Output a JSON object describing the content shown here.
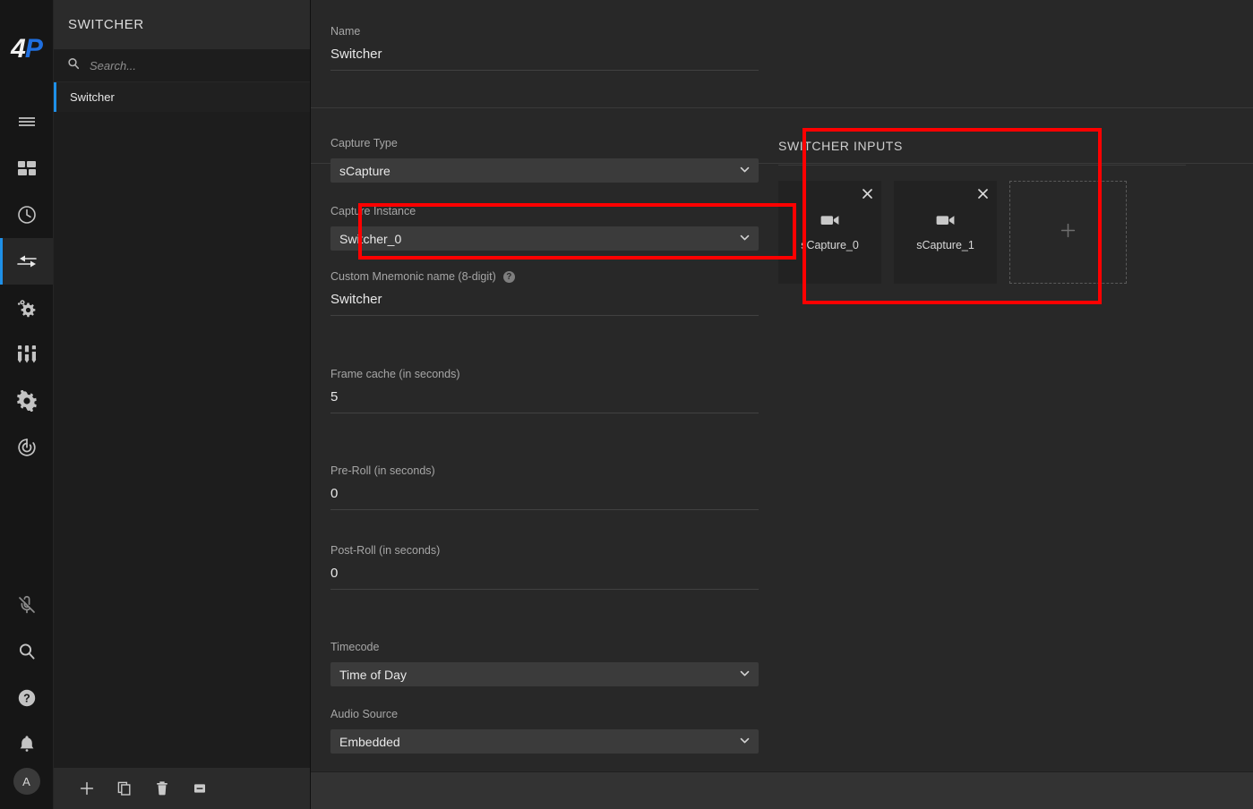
{
  "brand": {
    "logo_part1": "4",
    "logo_part2": "P",
    "accent_blue": "#1e90e8",
    "highlight_red": "#ff0000"
  },
  "rail": {
    "items": [
      {
        "icon": "hamburger-menu-icon",
        "label": "Menu"
      },
      {
        "icon": "dashboard-grid-icon",
        "label": "Dashboard"
      },
      {
        "icon": "clock-history-icon",
        "label": "History"
      },
      {
        "icon": "switcher-arrows-icon",
        "label": "Switcher"
      },
      {
        "icon": "automation-gears-icon",
        "label": "Automation"
      },
      {
        "icon": "mixer-faders-icon",
        "label": "Mixer"
      },
      {
        "icon": "settings-gear-icon",
        "label": "Settings"
      },
      {
        "icon": "power-radar-icon",
        "label": "Status"
      }
    ],
    "bottom_items": [
      {
        "icon": "microphone-muted-icon",
        "label": "Microphone muted"
      },
      {
        "icon": "search-icon",
        "label": "Search"
      },
      {
        "icon": "help-circle-icon",
        "label": "Help"
      },
      {
        "icon": "bell-icon",
        "label": "Notifications"
      }
    ],
    "avatar_initial": "A",
    "active_index": 3
  },
  "list_panel": {
    "header": "SWITCHER",
    "search": {
      "value": "",
      "placeholder": "Search..."
    },
    "items": [
      {
        "label": "Switcher",
        "selected": true
      }
    ],
    "footer_buttons": [
      {
        "icon": "plus-icon",
        "label": "Add"
      },
      {
        "icon": "copy-icon",
        "label": "Duplicate"
      },
      {
        "icon": "trash-icon",
        "label": "Delete"
      },
      {
        "icon": "minus-square-icon",
        "label": "Remove"
      }
    ]
  },
  "form": {
    "name": {
      "label": "Name",
      "value": "Switcher"
    },
    "capture_type": {
      "label": "Capture Type",
      "value": "sCapture"
    },
    "capture_instance": {
      "label": "Capture Instance",
      "value": "Switcher_0",
      "highlighted": true
    },
    "mnemonic": {
      "label": "Custom Mnemonic name (8-digit)",
      "value": "Switcher",
      "help": "?"
    },
    "frame_cache": {
      "label": "Frame cache (in seconds)",
      "value": "5"
    },
    "pre_roll": {
      "label": "Pre-Roll (in seconds)",
      "value": "0"
    },
    "post_roll": {
      "label": "Post-Roll (in seconds)",
      "value": "0"
    },
    "timecode": {
      "label": "Timecode",
      "value": "Time of Day"
    },
    "audio_source": {
      "label": "Audio Source",
      "value": "Embedded"
    }
  },
  "switcher_inputs": {
    "title": "SWITCHER INPUTS",
    "highlighted": true,
    "cards": [
      {
        "label": "sCapture_0",
        "icon": "video-camera-icon",
        "close": "×"
      },
      {
        "label": "sCapture_1",
        "icon": "video-camera-icon",
        "close": "×"
      }
    ],
    "add_card": {
      "icon": "plus-icon"
    }
  }
}
